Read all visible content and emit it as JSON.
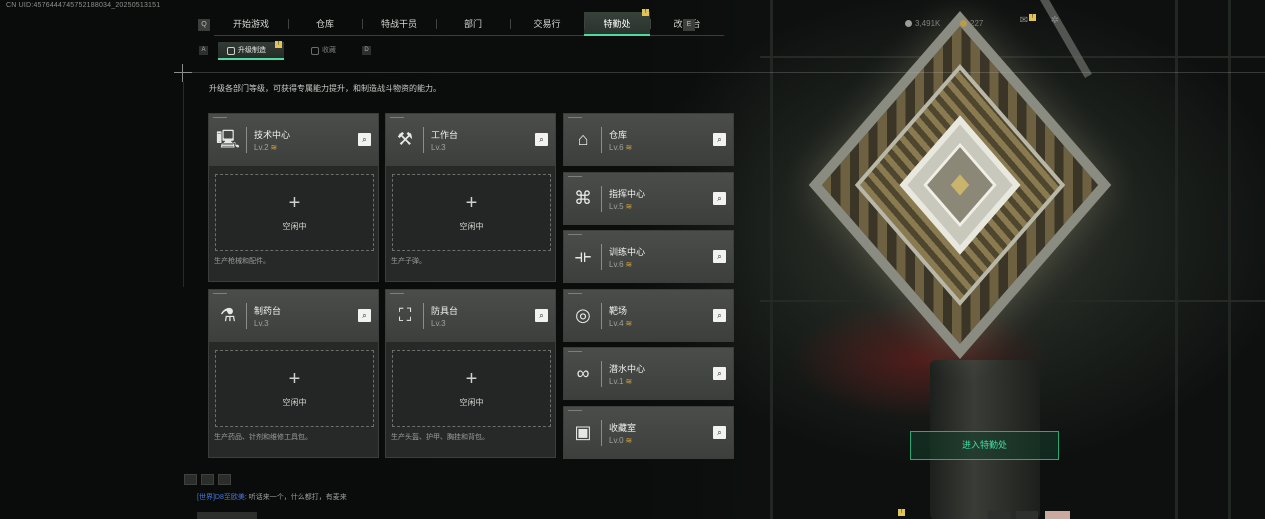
{
  "build_id": "CN UID:4576444745752188034_20250513151",
  "nav": {
    "prev_key": "Q",
    "next_key": "E",
    "tabs": [
      {
        "label": "开始游戏"
      },
      {
        "label": "仓库"
      },
      {
        "label": "特战干员"
      },
      {
        "label": "部门"
      },
      {
        "label": "交易行"
      },
      {
        "label": "特勤处",
        "active": true,
        "badge": "!"
      },
      {
        "label": "改枪台"
      }
    ]
  },
  "currency": {
    "coins": "3,491K",
    "gold": "227"
  },
  "hud": {
    "badge": "!"
  },
  "subnav": {
    "prev_key": "A",
    "next_key": "D",
    "tabs": [
      {
        "label": "升级制造",
        "active": true,
        "badge": "!"
      },
      {
        "label": "收藏"
      }
    ]
  },
  "description": "升级各部门等级，可获得专属能力提升，和制造战斗物资的能力。",
  "facilities": [
    {
      "name": "技术中心",
      "level": "Lv.2",
      "icon": "computer-icon",
      "upgradable": true,
      "slot_plus": "+",
      "slot_status": "空闲中",
      "produces": "生产枪械和配件。"
    },
    {
      "name": "工作台",
      "level": "Lv.3",
      "icon": "tools-icon",
      "upgradable": false,
      "slot_plus": "+",
      "slot_status": "空闲中",
      "produces": "生产子弹。"
    },
    {
      "name": "制药台",
      "level": "Lv.3",
      "icon": "microscope-icon",
      "upgradable": false,
      "slot_plus": "+",
      "slot_status": "空闲中",
      "produces": "生产药品、针剂和维修工具包。"
    },
    {
      "name": "防具台",
      "level": "Lv.3",
      "icon": "armor-blocks-icon",
      "upgradable": false,
      "slot_plus": "+",
      "slot_status": "空闲中",
      "produces": "生产头盔、护甲、胸挂和背包。"
    }
  ],
  "rooms": [
    {
      "name": "仓库",
      "level": "Lv.6",
      "icon": "warehouse-icon",
      "upgradable": true
    },
    {
      "name": "指挥中心",
      "level": "Lv.5",
      "icon": "command-chip-icon",
      "upgradable": true
    },
    {
      "name": "训练中心",
      "level": "Lv.6",
      "icon": "dumbbell-icon",
      "upgradable": true
    },
    {
      "name": "靶场",
      "level": "Lv.4",
      "icon": "target-icon",
      "upgradable": true
    },
    {
      "name": "潜水中心",
      "level": "Lv.1",
      "icon": "diving-goggles-icon",
      "upgradable": true
    },
    {
      "name": "收藏室",
      "level": "Lv.0",
      "icon": "collection-case-icon",
      "upgradable": true
    }
  ],
  "search_glyph": "⌕",
  "upgrade_glyph": "≋",
  "enter_button": "进入特勤处",
  "chat": {
    "channel": "[世界]",
    "nickname": "D8至欧美",
    "message": ": 听话来一个，什么都打，有麦来"
  },
  "bottom_badge": "!"
}
